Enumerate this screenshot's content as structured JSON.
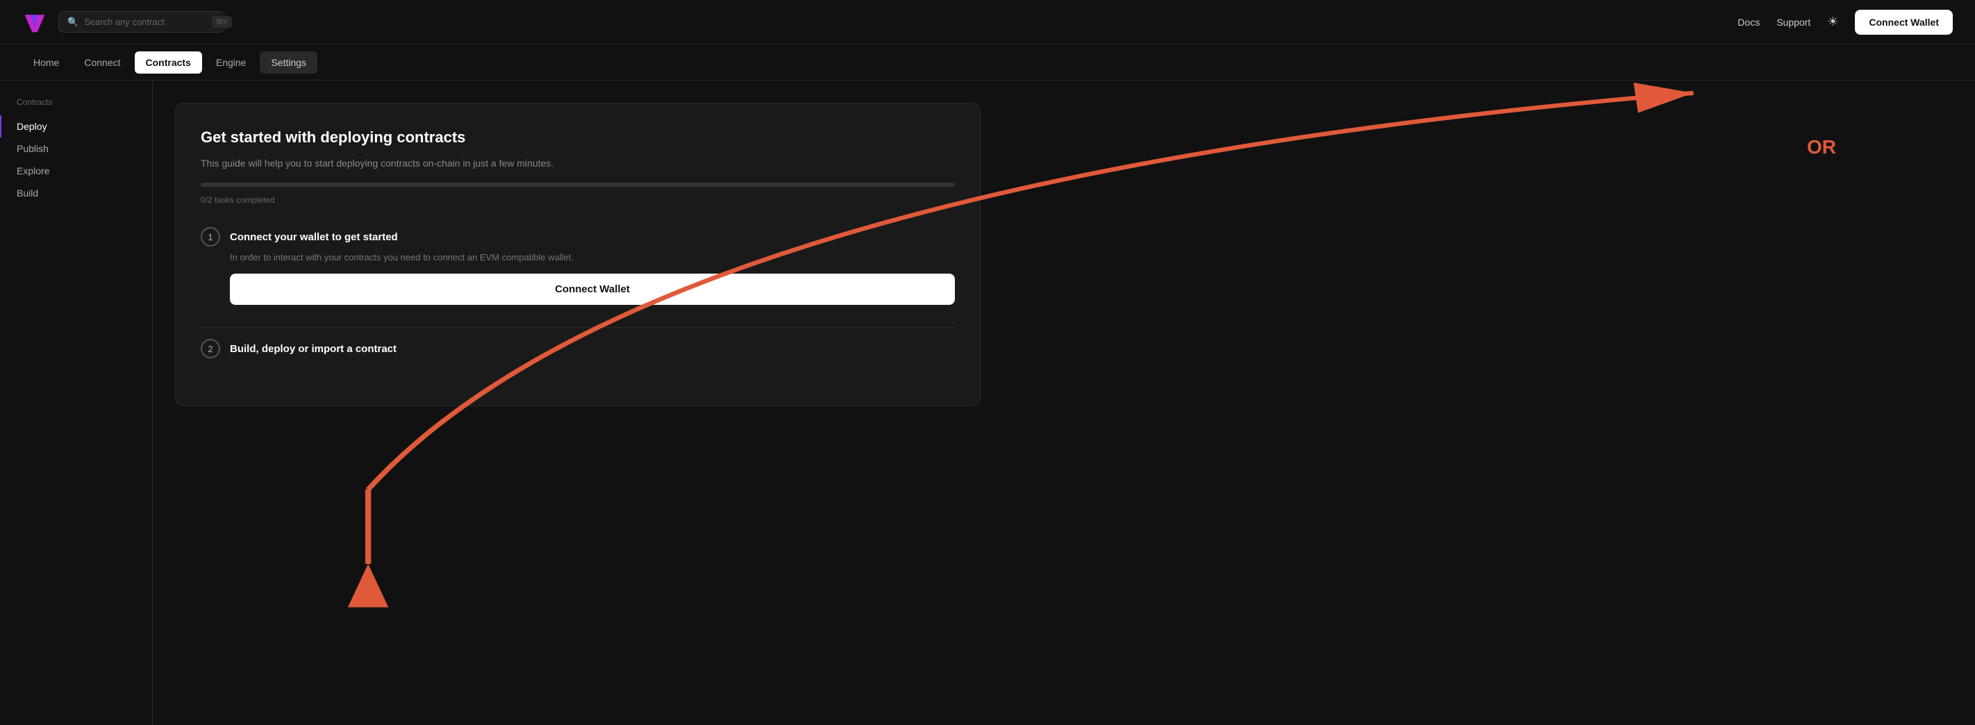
{
  "header": {
    "search_placeholder": "Search any contract",
    "search_shortcut": "⌘K",
    "docs_label": "Docs",
    "support_label": "Support",
    "connect_wallet_label": "Connect Wallet"
  },
  "nav": {
    "items": [
      {
        "label": "Home",
        "active": false
      },
      {
        "label": "Connect",
        "active": false
      },
      {
        "label": "Contracts",
        "active": true
      },
      {
        "label": "Engine",
        "active": false
      },
      {
        "label": "Settings",
        "active": false,
        "style": "settings"
      }
    ]
  },
  "sidebar": {
    "section_title": "Contracts",
    "items": [
      {
        "label": "Deploy",
        "active": true
      },
      {
        "label": "Publish",
        "active": false
      },
      {
        "label": "Explore",
        "active": false
      },
      {
        "label": "Build",
        "active": false
      }
    ]
  },
  "deploy_card": {
    "title": "Get started with deploying contracts",
    "description": "This guide will help you to start deploying contracts on-chain in just a few minutes.",
    "tasks_label": "0/2 tasks completed",
    "progress_pct": 0,
    "or_label": "OR",
    "task1": {
      "number": "1",
      "title": "Connect your wallet to get started",
      "description": "In order to interact with your contracts you need to connect an EVM compatible wallet.",
      "button_label": "Connect Wallet"
    },
    "task2": {
      "number": "2",
      "title": "Build, deploy or import a contract"
    }
  }
}
